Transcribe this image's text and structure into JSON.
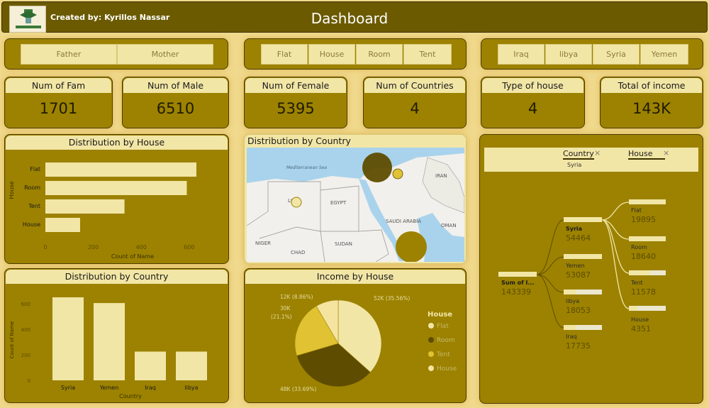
{
  "header": {
    "created_by": "Created by: Kyrillos Nassar",
    "title": "Dashboard"
  },
  "slicers": {
    "parent": [
      "Father",
      "Mother"
    ],
    "house": [
      "Flat",
      "House",
      "Room",
      "Tent"
    ],
    "country": [
      "Iraq",
      "libya",
      "Syria",
      "Yemen"
    ]
  },
  "cards": [
    {
      "label": "Num of Fam",
      "value": "1701"
    },
    {
      "label": "Num of Male",
      "value": "6510"
    },
    {
      "label": "Num of Female",
      "value": "5395"
    },
    {
      "label": "Num of Countries",
      "value": "4"
    },
    {
      "label": "Type of house",
      "value": "4"
    },
    {
      "label": "Total of income",
      "value": "143K"
    }
  ],
  "house_chart": {
    "title": "Distribution by House"
  },
  "country_bar": {
    "title": "Distribution by Country"
  },
  "map_panel": {
    "title": "Distribution by Country",
    "labels": {
      "sea": "Mediterranean Sea",
      "iran": "IRAN",
      "egypt": "EGYPT",
      "libya": "LIBYA",
      "saudi": "SAUDI ARABIA",
      "oman": "OMAN",
      "niger": "NIGER",
      "chad": "CHAD",
      "sudan": "SUDAN"
    }
  },
  "pie_panel": {
    "title": "Income by House",
    "legend_title": "House",
    "legend": [
      "Flat",
      "Room",
      "Tent",
      "House"
    ]
  },
  "tree": {
    "filter_country": "Country",
    "filter_house": "House",
    "filter_value": "Syria",
    "root_label": "Sum of I...",
    "root_value": "143339",
    "countries": [
      {
        "name": "Syria",
        "value": "54464"
      },
      {
        "name": "Yemen",
        "value": "53087"
      },
      {
        "name": "libya",
        "value": "18053"
      },
      {
        "name": "Iraq",
        "value": "17735"
      }
    ],
    "houses": [
      {
        "name": "Flat",
        "value": "19895"
      },
      {
        "name": "Room",
        "value": "18640"
      },
      {
        "name": "Tent",
        "value": "11578"
      },
      {
        "name": "House",
        "value": "4351"
      }
    ]
  },
  "chart_data": [
    {
      "type": "bar",
      "orientation": "horizontal",
      "title": "Distribution by House",
      "categories": [
        "Flat",
        "Room",
        "Tent",
        "House"
      ],
      "values": [
        630,
        590,
        330,
        145
      ],
      "xlabel": "Count of Name",
      "ylabel": "House",
      "xticks": [
        "0",
        "200",
        "400",
        "600"
      ],
      "xlim": [
        0,
        700
      ]
    },
    {
      "type": "bar",
      "title": "Distribution by Country",
      "categories": [
        "Syria",
        "Yemen",
        "Iraq",
        "libya"
      ],
      "values": [
        650,
        605,
        225,
        225
      ],
      "xlabel": "Country",
      "ylabel": "Count of Name",
      "yticks": [
        "0",
        "200",
        "400",
        "600"
      ],
      "ylim": [
        0,
        700
      ]
    },
    {
      "type": "pie",
      "title": "Income by House",
      "categories": [
        "Flat",
        "Room",
        "Tent",
        "House"
      ],
      "values": [
        52,
        48,
        30,
        12
      ],
      "slice_labels": [
        "52K (35.56%)",
        "48K (33.69%)",
        "30K (21.1%)",
        "12K (8.86%)"
      ],
      "colors": [
        "#f2e6a6",
        "#5e4c00",
        "#e0c232",
        "#f5e4a0"
      ]
    }
  ]
}
